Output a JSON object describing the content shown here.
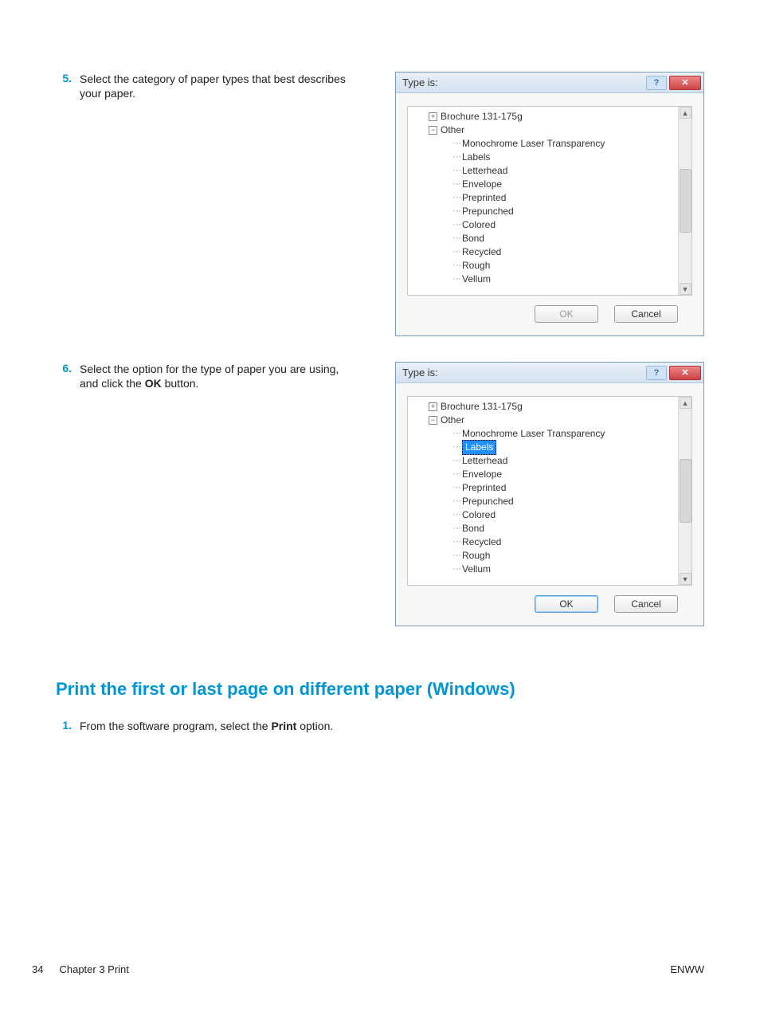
{
  "steps": {
    "s5": {
      "num": "5.",
      "text": "Select the category of paper types that best describes your paper."
    },
    "s6": {
      "num": "6.",
      "text_a": "Select the option for the type of paper you are using, and click the ",
      "bold": "OK",
      "text_b": " button."
    },
    "s1": {
      "num": "1.",
      "text_a": "From the software program, select the ",
      "bold": "Print",
      "text_b": " option."
    }
  },
  "dialog": {
    "title": "Type is:",
    "tree": {
      "root_a": "Brochure 131-175g",
      "root_b": "Other",
      "items": [
        "Monochrome Laser Transparency",
        "Labels",
        "Letterhead",
        "Envelope",
        "Preprinted",
        "Prepunched",
        "Colored",
        "Bond",
        "Recycled",
        "Rough",
        "Vellum"
      ],
      "selected_index_d2": 1
    },
    "ok": "OK",
    "cancel": "Cancel"
  },
  "section_heading": "Print the first or last page on different paper (Windows)",
  "footer": {
    "page": "34",
    "chapter": "Chapter 3   Print",
    "right": "ENWW"
  }
}
